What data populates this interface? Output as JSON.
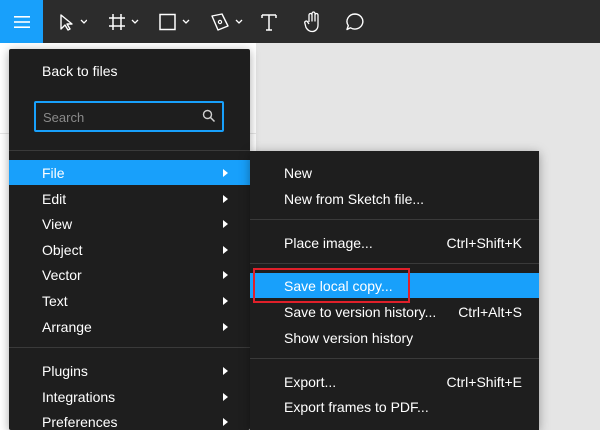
{
  "toolbar": {
    "tools": [
      {
        "name": "main-menu-icon"
      },
      {
        "name": "move-tool-icon"
      },
      {
        "name": "frame-tool-icon"
      },
      {
        "name": "shape-tool-icon"
      },
      {
        "name": "pen-tool-icon"
      },
      {
        "name": "text-tool-icon"
      },
      {
        "name": "hand-tool-icon"
      },
      {
        "name": "comment-tool-icon"
      }
    ],
    "accent": "#18a0fb"
  },
  "main_menu": {
    "back_label": "Back to files",
    "search_placeholder": "Search",
    "items": [
      {
        "label": "File",
        "active": true
      },
      {
        "label": "Edit"
      },
      {
        "label": "View"
      },
      {
        "label": "Object"
      },
      {
        "label": "Vector"
      },
      {
        "label": "Text"
      },
      {
        "label": "Arrange"
      },
      {
        "label": "Plugins"
      },
      {
        "label": "Integrations"
      },
      {
        "label": "Preferences"
      }
    ]
  },
  "file_submenu": {
    "items": [
      {
        "label": "New",
        "shortcut": ""
      },
      {
        "label": "New from Sketch file...",
        "shortcut": ""
      },
      {
        "label": "Place image...",
        "shortcut": "Ctrl+Shift+K"
      },
      {
        "label": "Save local copy...",
        "shortcut": "",
        "active": true
      },
      {
        "label": "Save to version history...",
        "shortcut": "Ctrl+Alt+S"
      },
      {
        "label": "Show version history",
        "shortcut": ""
      },
      {
        "label": "Export...",
        "shortcut": "Ctrl+Shift+E"
      },
      {
        "label": "Export frames to PDF...",
        "shortcut": ""
      }
    ]
  },
  "colors": {
    "menu_bg": "#1e1e1e",
    "highlight_outline": "#e0202a"
  }
}
